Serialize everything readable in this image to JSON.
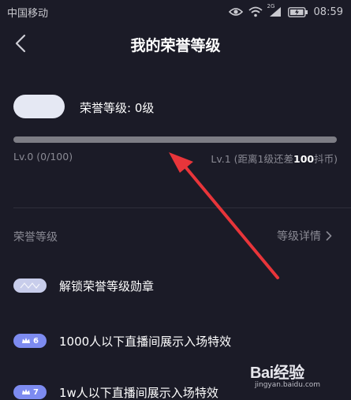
{
  "status_bar": {
    "carrier": "中国移动",
    "network": "2G",
    "time": "08:59"
  },
  "header": {
    "title": "我的荣誉等级"
  },
  "level_card": {
    "level_text": "荣誉等级: 0级",
    "progress_fraction": 0,
    "current_level": "Lv.0 (0/100)",
    "next_level_prefix": "Lv.1 (距离1级还差",
    "next_level_amount": "100",
    "next_level_suffix": "抖币)"
  },
  "section": {
    "title": "荣誉等级",
    "details_link": "等级详情"
  },
  "privileges": [
    {
      "badge": "",
      "label": "解锁荣誉等级勋章"
    },
    {
      "badge": "6",
      "label": "1000人以下直播间展示入场特效"
    },
    {
      "badge": "7",
      "label": "1w人以下直播间展示入场特效"
    }
  ],
  "watermark": {
    "main": "Bai经验",
    "sub": "jingyan.baidu.com"
  },
  "colors": {
    "background": "#1b1b27",
    "annotation_arrow": "#e8353a",
    "badge_purple": "#7d8bf0",
    "progress_track": "#7d7d85"
  }
}
